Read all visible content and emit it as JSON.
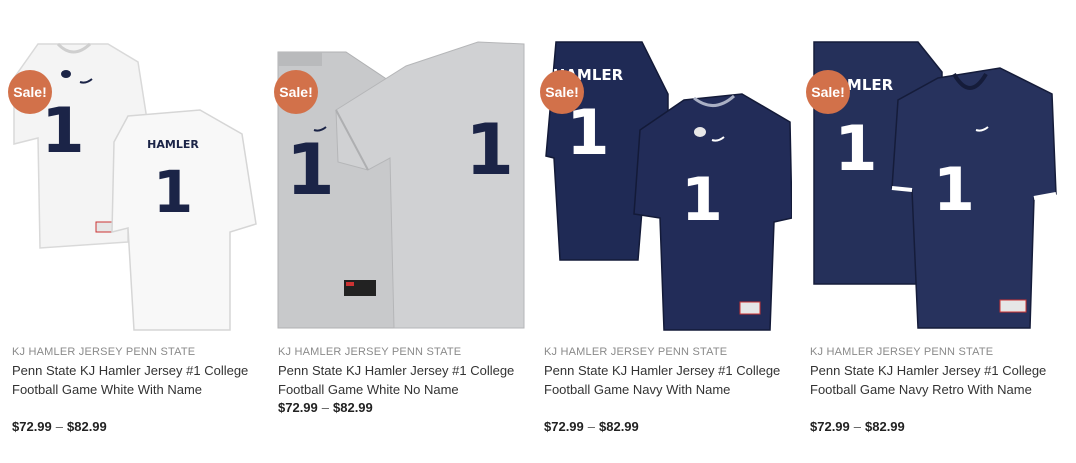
{
  "products": [
    {
      "sale_label": "Sale!",
      "category": "KJ HAMLER JERSEY PENN STATE",
      "title": "Penn State KJ Hamler Jersey #1 College Football Game White With Name",
      "price_min": "$72.99",
      "price_sep": "–",
      "price_max": "$82.99",
      "jersey": {
        "style": "white-with-name",
        "name_on_back": "HAMLER",
        "number": "1",
        "body_color": "#f4f4f4",
        "number_color": "#1b2447"
      }
    },
    {
      "sale_label": "Sale!",
      "category": "KJ HAMLER JERSEY PENN STATE",
      "title": "Penn State KJ Hamler Jersey #1 College Football Game White No Name",
      "price_min": "$72.99",
      "price_sep": "–",
      "price_max": "$82.99",
      "jersey": {
        "style": "white-no-name",
        "number": "1",
        "body_color": "#c9cacc",
        "number_color": "#1b2447"
      }
    },
    {
      "sale_label": "Sale!",
      "category": "KJ HAMLER JERSEY PENN STATE",
      "title": "Penn State KJ Hamler Jersey #1 College Football Game Navy With Name",
      "price_min": "$72.99",
      "price_sep": "–",
      "price_max": "$82.99",
      "jersey": {
        "style": "navy-with-name",
        "name_on_back": "HAMLER",
        "number": "1",
        "body_color": "#1f2a55",
        "number_color": "#ffffff"
      }
    },
    {
      "sale_label": "Sale!",
      "category": "KJ HAMLER JERSEY PENN STATE",
      "title": "Penn State KJ Hamler Jersey #1 College Football Game Navy Retro With Name",
      "price_min": "$72.99",
      "price_sep": "–",
      "price_max": "$82.99",
      "jersey": {
        "style": "navy-retro-with-name",
        "name_on_back": "HAMLER",
        "number": "1",
        "body_color": "#25305a",
        "number_color": "#ffffff"
      }
    }
  ],
  "colors": {
    "sale_badge": "#d2714a",
    "category_text": "#8a8a8a",
    "title_text": "#333333",
    "price_text": "#222222"
  }
}
